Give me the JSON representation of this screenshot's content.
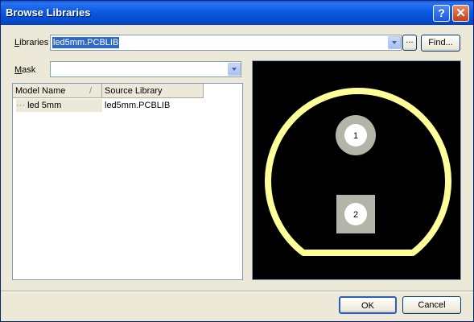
{
  "window": {
    "title": "Browse Libraries",
    "help_glyph": "?",
    "close_glyph": "✕"
  },
  "libraries": {
    "label_prefix": "",
    "label_u": "L",
    "label_rest": "ibraries",
    "value": "led5mm.PCBLIB",
    "more": "...",
    "find_label": "Find..."
  },
  "mask": {
    "label_u": "M",
    "label_rest": "ask",
    "value": ""
  },
  "table": {
    "columns": [
      "Model Name",
      "Source Library"
    ],
    "sort_glyph": "/",
    "rows": [
      {
        "model": "led 5mm",
        "source": "led5mm.PCBLIB"
      }
    ]
  },
  "preview": {
    "pads": [
      {
        "number": "1",
        "shape": "round"
      },
      {
        "number": "2",
        "shape": "square"
      }
    ],
    "outline_color": "#ffff99",
    "pad_color": "#b4b4a8"
  },
  "buttons": {
    "ok": "OK",
    "cancel": "Cancel"
  }
}
